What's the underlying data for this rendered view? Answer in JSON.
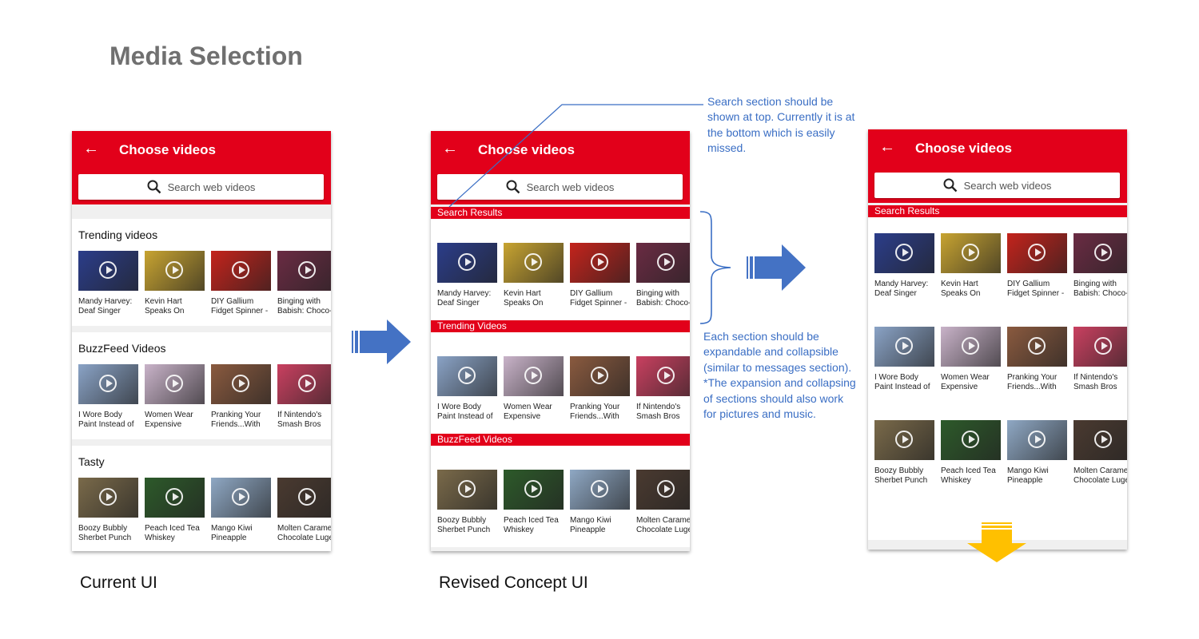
{
  "page": {
    "title": "Media Selection",
    "caption_current": "Current UI",
    "caption_revised": "Revised Concept UI"
  },
  "app": {
    "back_icon": "←",
    "title": "Choose videos",
    "search_placeholder": "Search web videos"
  },
  "current_ui": {
    "sections": [
      {
        "title": "Trending videos",
        "videos": [
          "Mandy Harvey: Deaf Singer",
          "Kevin Hart Speaks On",
          "DIY Gallium Fidget Spinner -",
          "Binging with Babish: Choco-"
        ]
      },
      {
        "title": "BuzzFeed Videos",
        "videos": [
          "I Wore Body Paint Instead of",
          "Women Wear Expensive",
          "Pranking Your Friends...With",
          "If Nintendo's Smash Bros"
        ]
      },
      {
        "title": "Tasty",
        "videos": [
          "Boozy Bubbly Sherbet Punch",
          "Peach Iced Tea Whiskey",
          "Mango Kiwi Pineapple",
          "Molten Caramel Chocolate Luge"
        ]
      }
    ]
  },
  "revised_ui": {
    "sections": [
      {
        "title": "Search Results",
        "videos": [
          "Mandy Harvey: Deaf Singer",
          "Kevin Hart Speaks On",
          "DIY Gallium Fidget Spinner -",
          "Binging with Babish: Choco-"
        ]
      },
      {
        "title": "Trending Videos",
        "videos": [
          "I Wore Body Paint Instead of",
          "Women Wear Expensive",
          "Pranking Your Friends...With",
          "If Nintendo's Smash Bros"
        ]
      },
      {
        "title": "BuzzFeed Videos",
        "videos": [
          "Boozy Bubbly Sherbet Punch",
          "Peach Iced Tea Whiskey",
          "Mango Kiwi Pineapple",
          "Molten Caramel Chocolate Luge"
        ]
      }
    ]
  },
  "expanded_ui": {
    "section_title": "Search Results",
    "rows": [
      [
        "Mandy Harvey: Deaf Singer",
        "Kevin Hart Speaks On",
        "DIY Gallium Fidget Spinner -",
        "Binging with Babish: Choco-"
      ],
      [
        "I Wore Body Paint Instead of",
        "Women Wear Expensive",
        "Pranking Your Friends...With",
        "If Nintendo's Smash Bros"
      ],
      [
        "Boozy Bubbly Sherbet Punch",
        "Peach Iced Tea Whiskey",
        "Mango Kiwi Pineapple",
        "Molten Caramel Chocolate Luge"
      ]
    ]
  },
  "notes": {
    "search_note": "Search section should be shown at top.  Currently it is at the bottom  which is easily missed.",
    "expand_note": "Each section should be expandable and collapsible (similar to messages section).\n*The expansion and collapsing of sections should also work for pictures and music."
  },
  "thumb_colors": [
    [
      "#2b3d8a",
      "#c8a431",
      "#c4231c",
      "#6a2b43"
    ],
    [
      "#8aa3c6",
      "#c9b3c9",
      "#8a5a3f",
      "#c94060"
    ],
    [
      "#7a6a4a",
      "#2d5a2a",
      "#8fa8c4",
      "#4a3a30"
    ]
  ],
  "colors": {
    "brand_red": "#e2001a",
    "note_blue": "#3a6ec4",
    "arrow_blue": "#4472c4",
    "arrow_yellow": "#ffc000"
  }
}
